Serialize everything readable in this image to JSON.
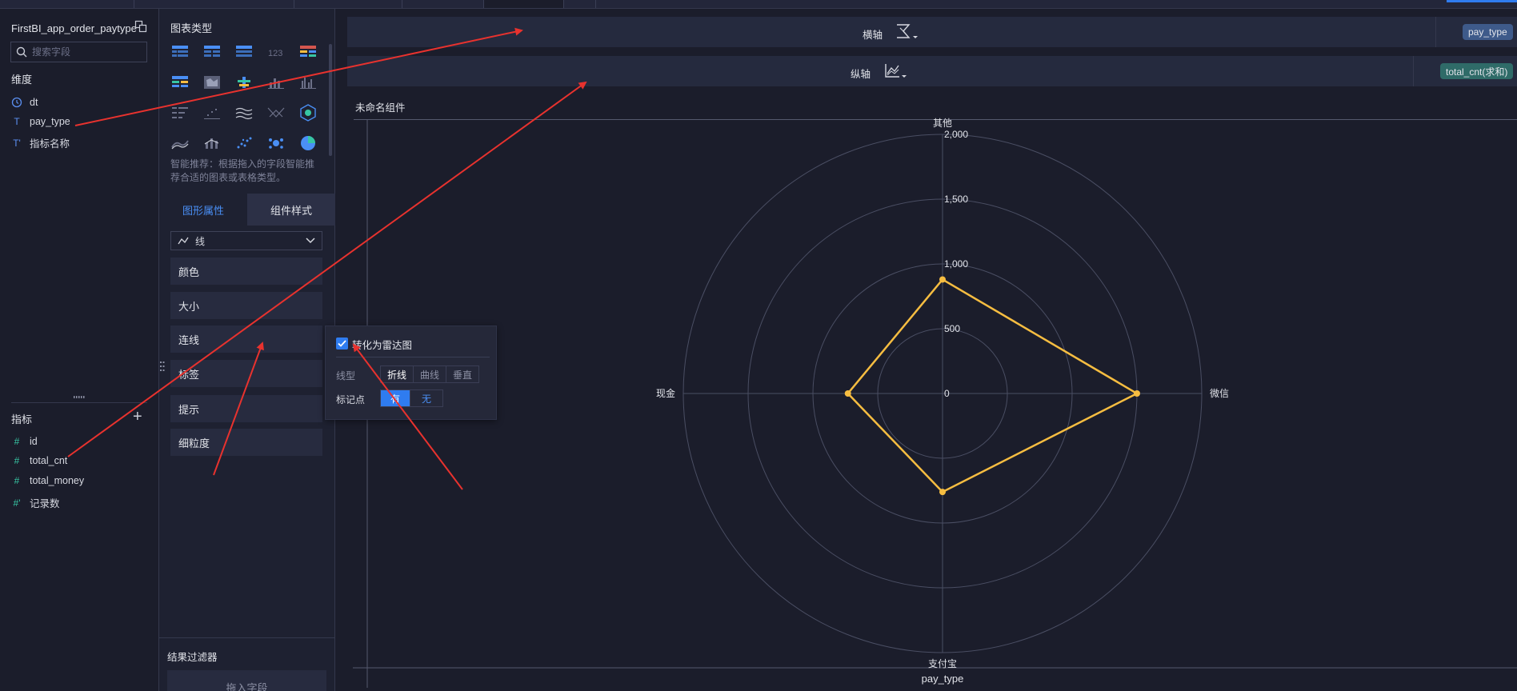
{
  "dataset": {
    "name": "FirstBI_app_order_paytype"
  },
  "search": {
    "placeholder": "搜索字段"
  },
  "dimensions": {
    "label": "维度",
    "items": [
      {
        "icon": "clock-icon",
        "name": "dt"
      },
      {
        "icon": "text-type-icon",
        "name": "pay_type"
      },
      {
        "icon": "text-type-icon",
        "name": "指标名称"
      }
    ]
  },
  "measures": {
    "label": "指标",
    "items": [
      {
        "icon": "number-type-icon",
        "name": "id"
      },
      {
        "icon": "number-type-icon",
        "name": "total_cnt"
      },
      {
        "icon": "number-type-icon",
        "name": "total_money"
      },
      {
        "icon": "number-type-icon",
        "name": "记录数"
      }
    ]
  },
  "chart_types": {
    "title": "图表类型",
    "hint": "智能推荐：根据拖入的字段智能推荐合适的图表或表格类型。"
  },
  "tabs": {
    "graph_props": "图形属性",
    "component_style": "组件样式"
  },
  "mark_select": {
    "value": "线"
  },
  "props": [
    "颜色",
    "大小",
    "连线",
    "标签",
    "提示",
    "细粒度"
  ],
  "filter": {
    "title": "结果过滤器",
    "drop_hint": "拖入字段"
  },
  "popup": {
    "checkbox_label": "转化为雷达图",
    "checked": true,
    "line_type_label": "线型",
    "line_types": [
      "折线",
      "曲线",
      "垂直"
    ],
    "line_type_selected": "折线",
    "marker_label": "标记点",
    "marker_options": [
      "有",
      "无"
    ],
    "marker_selected": "有"
  },
  "x_axis": {
    "label": "横轴",
    "field": "pay_type"
  },
  "y_axis": {
    "label": "纵轴",
    "field": "total_cnt(求和)"
  },
  "component": {
    "title": "未命名组件"
  },
  "colors": {
    "accent": "#2f7cf0",
    "series": "#f6bd41",
    "pill_blue": "#3e5a8a",
    "pill_green": "#2f6b68",
    "arrow": "#e8322e"
  },
  "chart_data": {
    "type": "radar",
    "categories": [
      "其他",
      "微信",
      "支付宝",
      "现金"
    ],
    "series": [
      {
        "values": [
          880,
          1500,
          760,
          730
        ]
      }
    ],
    "rmax": 2000,
    "ticks": [
      "0",
      "500",
      "1,000",
      "1,500",
      "2,000"
    ],
    "xlabel": "pay_type"
  }
}
